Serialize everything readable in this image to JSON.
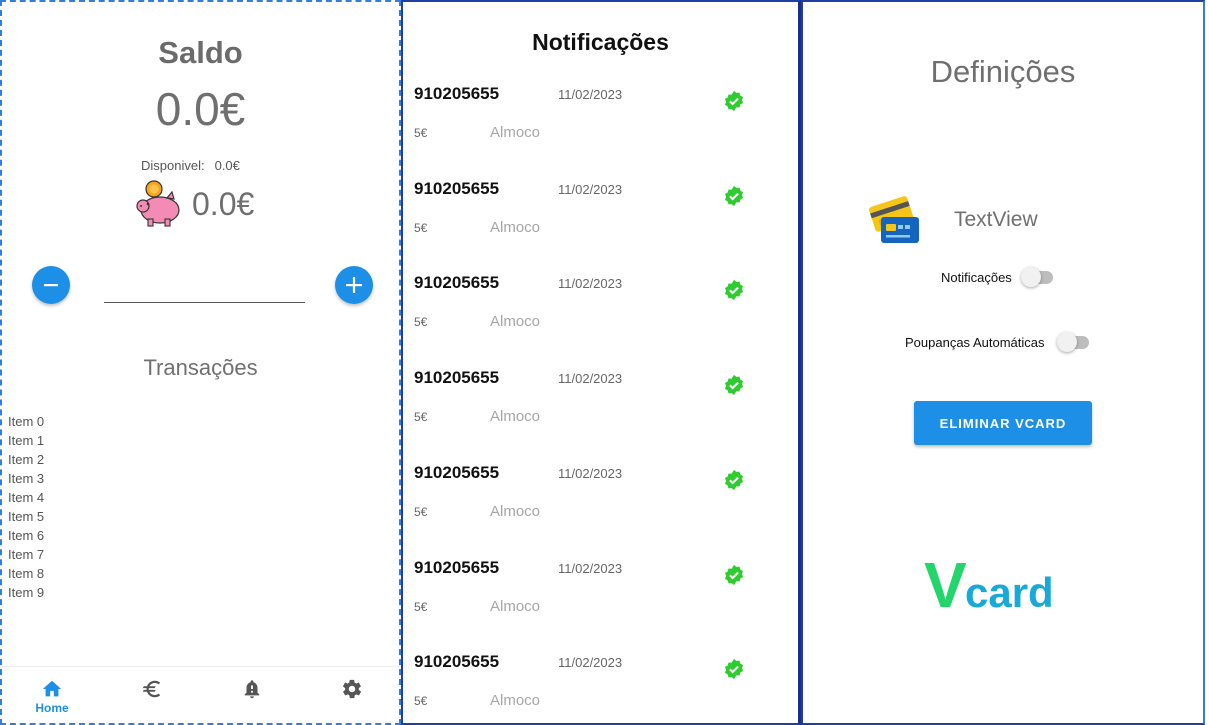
{
  "home": {
    "title": "Saldo",
    "balance": "0.0€",
    "available_label": "Disponivel:",
    "available_value": "0.0€",
    "savings_value": "0.0€",
    "amount_input_value": "",
    "transactions_title": "Transações",
    "transactions": [
      "Item 0",
      "Item 1",
      "Item 2",
      "Item 3",
      "Item 4",
      "Item 5",
      "Item 6",
      "Item 7",
      "Item 8",
      "Item 9"
    ],
    "nav": {
      "home_label": "Home"
    },
    "accent_color": "#1e8fe6"
  },
  "notifications": {
    "title": "Notificações",
    "items": [
      {
        "phone": "910205655",
        "date": "11/02/2023",
        "amount": "5€",
        "description": "Almoco",
        "status": "check-icon"
      },
      {
        "phone": "910205655",
        "date": "11/02/2023",
        "amount": "5€",
        "description": "Almoco",
        "status": "check-icon"
      },
      {
        "phone": "910205655",
        "date": "11/02/2023",
        "amount": "5€",
        "description": "Almoco",
        "status": "check-icon"
      },
      {
        "phone": "910205655",
        "date": "11/02/2023",
        "amount": "5€",
        "description": "Almoco",
        "status": "check-icon"
      },
      {
        "phone": "910205655",
        "date": "11/02/2023",
        "amount": "5€",
        "description": "Almoco",
        "status": "check-icon"
      },
      {
        "phone": "910205655",
        "date": "11/02/2023",
        "amount": "5€",
        "description": "Almoco",
        "status": "check-icon"
      },
      {
        "phone": "910205655",
        "date": "11/02/2023",
        "amount": "5€",
        "description": "Almoco",
        "status": "check-icon"
      }
    ],
    "check_color": "#2ecc2e"
  },
  "settings": {
    "title": "Definições",
    "card_label": "TextView",
    "notifications_label": "Notificações",
    "notifications_on": false,
    "auto_savings_label": "Poupanças Automáticas",
    "auto_savings_on": false,
    "delete_button": "ELIMINAR VCARD",
    "logo_v": "V",
    "logo_rest": "card"
  }
}
